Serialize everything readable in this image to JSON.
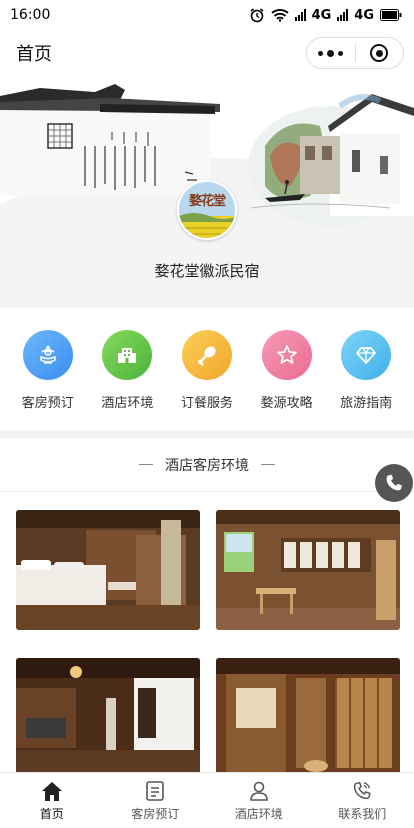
{
  "status_bar": {
    "time": "16:00",
    "network_1": "4G",
    "network_2": "4G"
  },
  "nav": {
    "title": "首页"
  },
  "banner": {
    "logo_text": "婺花堂",
    "hotel_name": "婺花堂徽派民宿"
  },
  "menu": [
    {
      "label": "客房预订",
      "icon": "flower-icon",
      "color": "#4a9ff5"
    },
    {
      "label": "酒店环境",
      "icon": "building-icon",
      "color": "#6cc84a"
    },
    {
      "label": "订餐服务",
      "icon": "drumstick-icon",
      "color": "#f5b83c"
    },
    {
      "label": "婺源攻略",
      "icon": "star-icon",
      "color": "#f07fa0"
    },
    {
      "label": "旅游指南",
      "icon": "diamond-icon",
      "color": "#5cc4f2"
    }
  ],
  "section": {
    "title": "酒店客房环境"
  },
  "tabs": [
    {
      "label": "首页",
      "icon": "home-icon",
      "active": true
    },
    {
      "label": "客房预订",
      "icon": "document-icon",
      "active": false
    },
    {
      "label": "酒店环境",
      "icon": "user-icon",
      "active": false
    },
    {
      "label": "联系我们",
      "icon": "phone-icon",
      "active": false
    }
  ]
}
